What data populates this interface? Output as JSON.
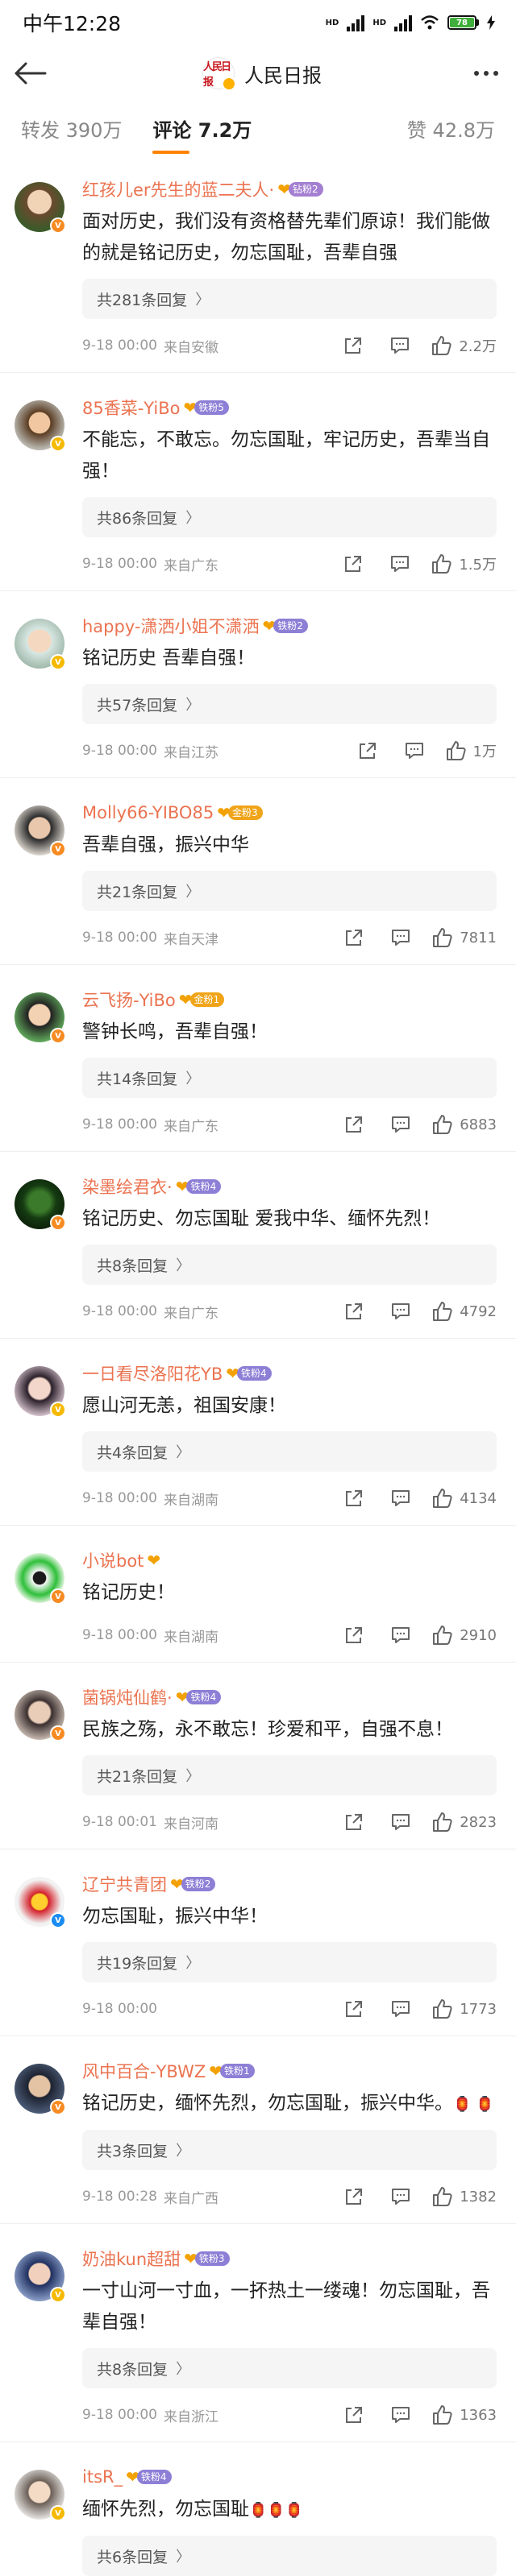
{
  "status": {
    "time": "中午12:28",
    "battery": "78",
    "net1": "HD",
    "net2": "HD"
  },
  "nav": {
    "title": "人民日报",
    "logo_text": "人民日报"
  },
  "tabs": [
    {
      "label": "转发 390万"
    },
    {
      "label": "评论 7.2万"
    },
    {
      "label": "赞 42.8万"
    }
  ],
  "comments": [
    {
      "name": "红孩儿er先生的蓝二夫人·",
      "fan_level": "钻粉2",
      "text": "面对历史，我们没有资格替先辈们原谅！我们能做的就是铭记历史，勿忘国耻，吾辈自强",
      "replies": "共281条回复",
      "date": "9-18 00:00",
      "location": "来自安徽",
      "likes": "2.2万"
    },
    {
      "name": "85香菜-YiBo",
      "fan_level": "铁粉5",
      "text": "不能忘，不敢忘。勿忘国耻，牢记历史，吾辈当自强！",
      "replies": "共86条回复",
      "date": "9-18 00:00",
      "location": "来自广东",
      "likes": "1.5万"
    },
    {
      "name": "happy-潇洒小姐不潇洒",
      "fan_level": "铁粉2",
      "text": "铭记历史 吾辈自强！",
      "replies": "共57条回复",
      "date": "9-18 00:00",
      "location": "来自江苏",
      "likes": "1万"
    },
    {
      "name": "Molly66-YIBO85",
      "fan_level": "金粉3",
      "text": "吾辈自强，振兴中华",
      "replies": "共21条回复",
      "date": "9-18 00:00",
      "location": "来自天津",
      "likes": "7811"
    },
    {
      "name": "云飞扬-YiBo",
      "fan_level": "金粉1",
      "text": "警钟长鸣，吾辈自强！",
      "replies": "共14条回复",
      "date": "9-18 00:00",
      "location": "来自广东",
      "likes": "6883"
    },
    {
      "name": "染墨绘君衣·",
      "fan_level": "铁粉4",
      "text": "铭记历史、勿忘国耻 爱我中华、缅怀先烈！",
      "replies": "共8条回复",
      "date": "9-18 00:00",
      "location": "来自广东",
      "likes": "4792"
    },
    {
      "name": "一日看尽洛阳花YB",
      "fan_level": "铁粉4",
      "text": "愿山河无恙，祖国安康！",
      "replies": "共4条回复",
      "date": "9-18 00:00",
      "location": "来自湖南",
      "likes": "4134"
    },
    {
      "name": "小说bot",
      "fan_level": "",
      "text": "铭记历史！",
      "replies": "",
      "date": "9-18 00:00",
      "location": "来自湖南",
      "likes": "2910"
    },
    {
      "name": "菌锅炖仙鹤·",
      "fan_level": "铁粉4",
      "text": "民族之殇，永不敢忘！珍爱和平，自强不息！",
      "replies": "共21条回复",
      "date": "9-18 00:01",
      "location": "来自河南",
      "likes": "2823"
    },
    {
      "name": "辽宁共青团",
      "fan_level": "铁粉2",
      "text": "勿忘国耻，振兴中华！",
      "replies": "共19条回复",
      "date": "9-18 00:00",
      "location": "",
      "likes": "1773"
    },
    {
      "name": "风中百合-YBWZ",
      "fan_level": "铁粉1",
      "text": "铭记历史，缅怀先烈，勿忘国耻，振兴中华。",
      "replies": "共3条回复",
      "date": "9-18 00:28",
      "location": "来自广西",
      "likes": "1382"
    },
    {
      "name": "奶油kun超甜",
      "fan_level": "铁粉3",
      "text": "一寸山河一寸血，一抔热土一缕魂！勿忘国耻，吾辈自强！",
      "replies": "共8条回复",
      "date": "9-18 00:00",
      "location": "来自浙江",
      "likes": "1363"
    },
    {
      "name": "itsR_",
      "fan_level": "铁粉4",
      "text": "缅怀先烈，勿忘国耻",
      "replies": "共6条回复",
      "date": "",
      "location": "",
      "likes": ""
    }
  ]
}
